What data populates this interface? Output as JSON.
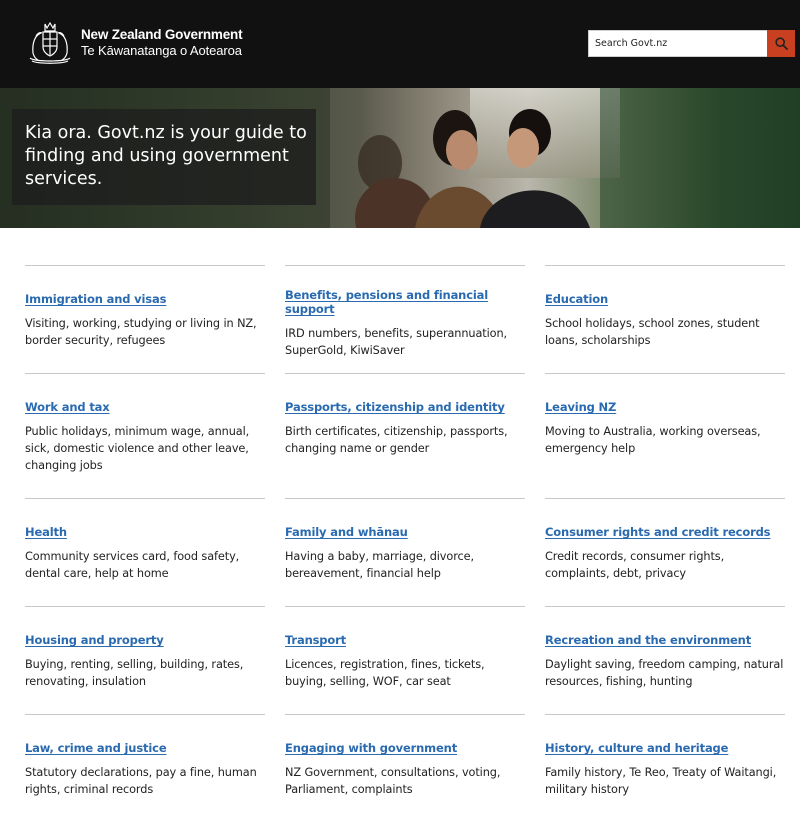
{
  "header": {
    "logo_title": "New Zealand Government",
    "logo_subtitle": "Te Kāwanatanga o Aotearoa",
    "search_placeholder": "Search Govt.nz",
    "search_icon": "search-icon",
    "accent_color": "#c8401f"
  },
  "hero": {
    "text": "Kia ora. Govt.nz is your guide to finding and using government services."
  },
  "categories": [
    {
      "title": "Immigration and visas",
      "desc": "Visiting, working, studying or living in NZ, border security, refugees"
    },
    {
      "title": "Benefits, pensions and financial support",
      "desc": "IRD numbers, benefits, superannuation, SuperGold, KiwiSaver"
    },
    {
      "title": "Education",
      "desc": "School holidays, school zones, student loans, scholarships"
    },
    {
      "title": "Work and tax",
      "desc": "Public holidays, minimum wage, annual, sick, domestic violence and other leave, changing jobs"
    },
    {
      "title": "Passports, citizenship and identity",
      "desc": "Birth certificates, citizenship, passports, changing name or gender"
    },
    {
      "title": "Leaving NZ",
      "desc": "Moving to Australia, working overseas, emergency help"
    },
    {
      "title": "Health",
      "desc": "Community services card, food safety, dental care, help at home"
    },
    {
      "title": "Family and whānau",
      "desc": "Having a baby, marriage, divorce, bereavement, financial help"
    },
    {
      "title": "Consumer rights and credit records",
      "desc": "Credit records, consumer rights, complaints, debt, privacy"
    },
    {
      "title": "Housing and property",
      "desc": "Buying, renting, selling, building, rates, renovating, insulation"
    },
    {
      "title": "Transport",
      "desc": "Licences, registration, fines, tickets, buying, selling, WOF, car seat"
    },
    {
      "title": "Recreation and the environment",
      "desc": "Daylight saving, freedom camping, natural resources, fishing, hunting"
    },
    {
      "title": "Law, crime and justice",
      "desc": "Statutory declarations, pay a fine, human rights, criminal records"
    },
    {
      "title": "Engaging with government",
      "desc": "NZ Government, consultations, voting, Parliament, complaints"
    },
    {
      "title": "History, culture and heritage",
      "desc": "Family history, Te Reo, Treaty of Waitangi, military history"
    }
  ]
}
